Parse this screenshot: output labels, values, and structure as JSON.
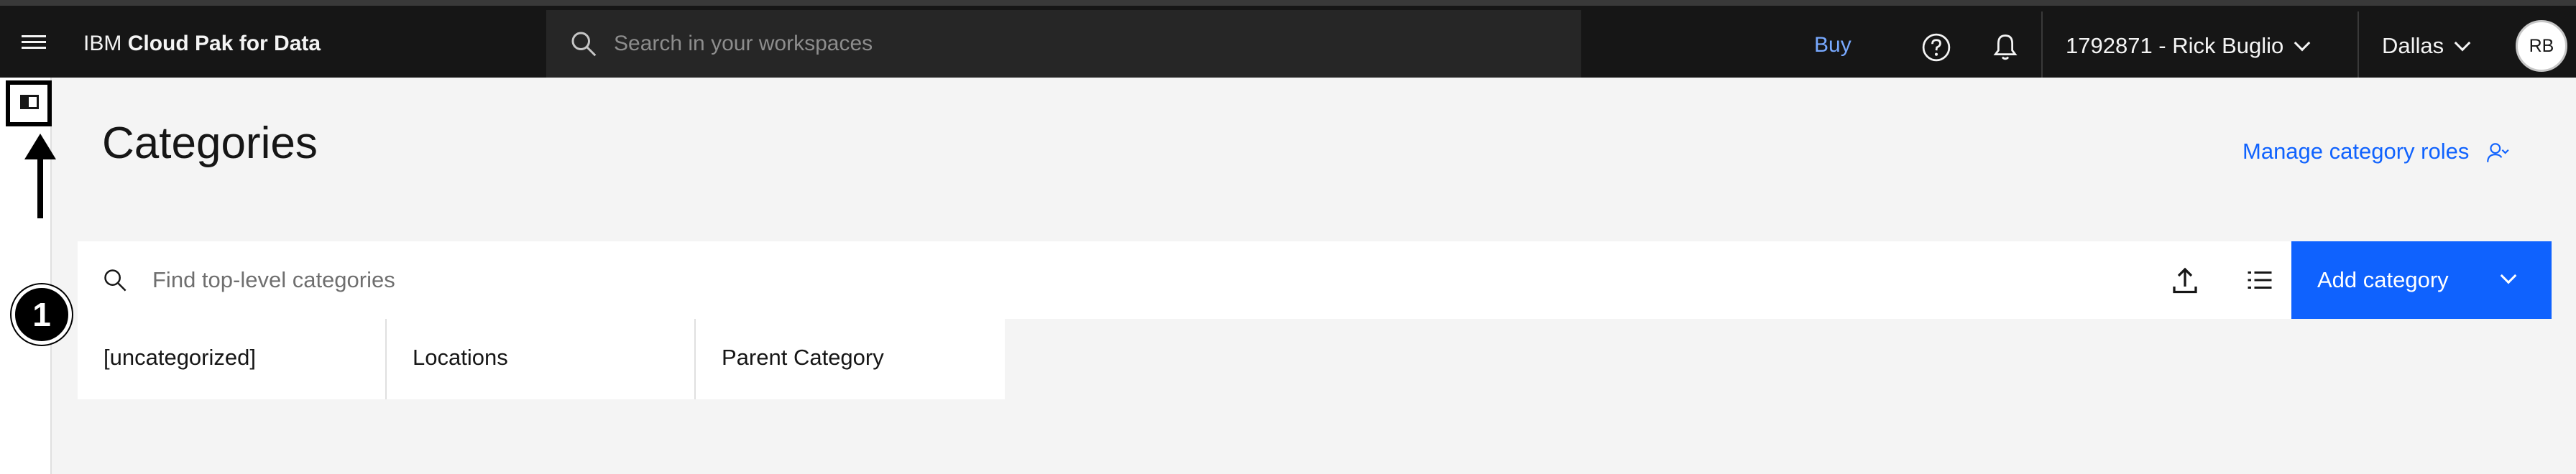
{
  "header": {
    "brand_prefix": "IBM",
    "brand_name": "Cloud Pak for Data",
    "search_placeholder": "Search in your workspaces",
    "buy_label": "Buy",
    "account_label": "1792871 - Rick Buglio",
    "region_label": "Dallas",
    "avatar_initials": "RB"
  },
  "annotation": {
    "step_number": "1"
  },
  "main": {
    "title": "Categories",
    "manage_roles_label": "Manage category roles",
    "find_placeholder": "Find top-level categories",
    "add_button_label": "Add category",
    "categories": [
      {
        "name": "[uncategorized]"
      },
      {
        "name": "Locations"
      },
      {
        "name": "Parent Category"
      }
    ]
  },
  "colors": {
    "header_bg": "#161616",
    "accent": "#0f62fe",
    "buy_link": "#78a9ff",
    "page_bg": "#f4f4f4"
  }
}
